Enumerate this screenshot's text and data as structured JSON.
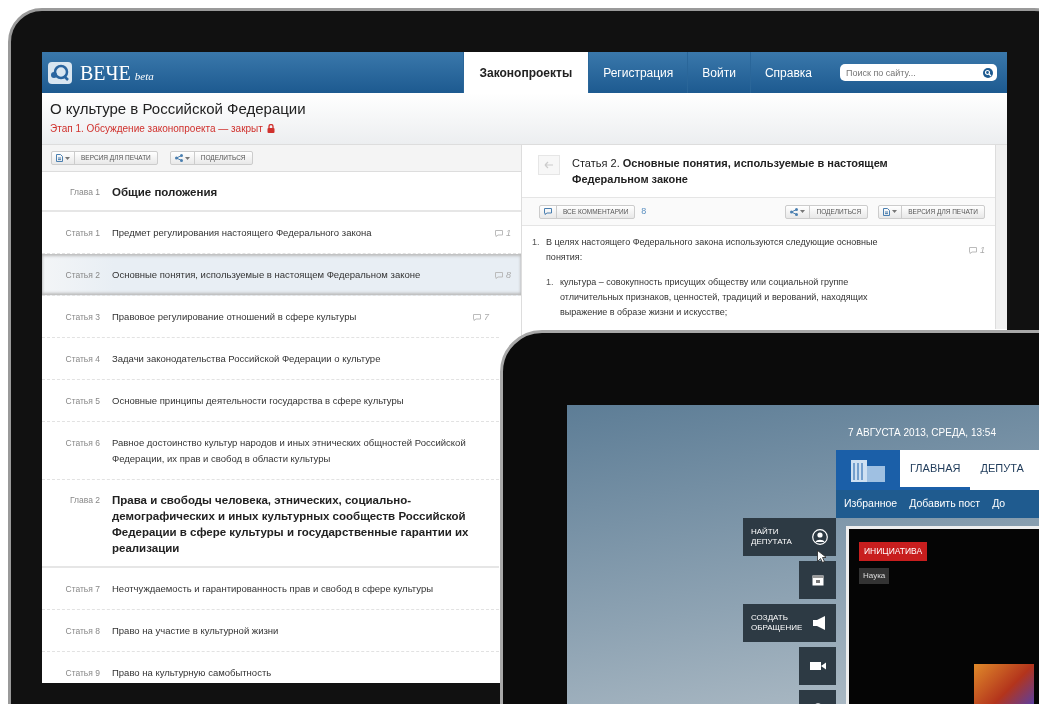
{
  "site": {
    "logo": "ВЕЧЕ",
    "logo_suffix": "beta",
    "nav": [
      {
        "label": "Законопроекты",
        "selected": true
      },
      {
        "label": "Регистрация",
        "selected": false
      },
      {
        "label": "Войти",
        "selected": false
      },
      {
        "label": "Справка",
        "selected": false
      }
    ],
    "search": {
      "placeholder": "Поиск по сайту..."
    },
    "law": {
      "title": "О культуре в Российской Федерации",
      "stage": "Этап 1. Обсуждение законопроекта — закрыт",
      "locked": true
    },
    "toolbar": [
      {
        "kind": "document",
        "label": "ВЕРСИЯ ДЛЯ ПЕЧАТИ"
      },
      {
        "kind": "share",
        "label": "ПОДЕЛИТЬСЯ"
      }
    ],
    "toc": [
      {
        "kind": "chapter",
        "number": "Глава 1",
        "title": "Общие положения",
        "selected": false
      },
      {
        "kind": "article",
        "number": "Статья 1",
        "title": "Предмет регулирования настоящего Федерального закона",
        "comments": "1",
        "selected": false
      },
      {
        "kind": "article",
        "number": "Статья 2",
        "title": "Основные понятия, используемые в настоящем Федеральном законе",
        "comments": "8",
        "selected": true
      },
      {
        "kind": "article",
        "number": "Статья 3",
        "title": "Правовое регулирование отношений в сфере культуры",
        "comments": "7",
        "selected": false
      },
      {
        "kind": "article",
        "number": "Статья 4",
        "title": "Задачи законодательства Российской Федерации о культуре",
        "selected": false
      },
      {
        "kind": "article",
        "number": "Статья 5",
        "title": "Основные принципы деятельности государства в сфере культуры",
        "selected": false
      },
      {
        "kind": "article",
        "number": "Статья 6",
        "title": "Равное достоинство культур народов и иных этнических общностей Российской Федерации, их прав и свобод в области культуры",
        "selected": false
      },
      {
        "kind": "chapter",
        "number": "Глава 2",
        "title": "Права и свободы человека, этнических, социально-демографических и иных культурных сообществ Российской Федерации в сфере культуры и государственные гарантии их реализации",
        "selected": false
      },
      {
        "kind": "article",
        "number": "Статья 7",
        "title": "Неотчуждаемость и гарантированность прав и свобод в сфере культуры",
        "selected": false
      },
      {
        "kind": "article",
        "number": "Статья 8",
        "title": "Право на участие в культурной жизни",
        "selected": false
      },
      {
        "kind": "article",
        "number": "Статья 9",
        "title": "Право на культурную самобытность",
        "selected": false
      }
    ],
    "article": {
      "number": "Статья 2.",
      "title": "Основные понятия, используемые в настоящем Федеральном законе",
      "comments_button": "ВСЕ КОММЕНТАРИИ",
      "comments_count": "8",
      "buttons": [
        {
          "kind": "share",
          "label": "ПОДЕЛИТЬСЯ"
        },
        {
          "kind": "document",
          "label": "ВЕРСИЯ ДЛЯ ПЕЧАТИ"
        }
      ],
      "paragraphs": [
        {
          "number": "1.",
          "text": "В целях настоящего Федерального закона используются следующие основные понятия:",
          "comments": "1",
          "children": [
            {
              "number": "1.",
              "text": "культура – совокупность присущих обществу или социальной группе отличительных признаков, ценностей, традиций и верований, находящих выражение в образе жизни и искусстве;"
            }
          ]
        }
      ]
    }
  },
  "portal": {
    "date": "7 АВГУСТА 2013, СРЕДА, 13:54",
    "nav": [
      {
        "label": "ГЛАВНАЯ",
        "selected": true
      },
      {
        "label": "ДЕПУТА",
        "selected": false
      }
    ],
    "subnav": [
      "Избранное",
      "Добавить пост",
      "До"
    ],
    "side_buttons": [
      {
        "kind": "person",
        "label": "НАЙТИ ДЕПУТАТА"
      },
      {
        "kind": "calendar"
      },
      {
        "kind": "megaphone",
        "label": "СОЗДАТЬ ОБРАЩЕНИЕ"
      },
      {
        "kind": "video"
      },
      {
        "kind": "circle"
      }
    ],
    "feature": {
      "tag": "ИНИЦИАТИВА",
      "category": "Наука"
    }
  }
}
